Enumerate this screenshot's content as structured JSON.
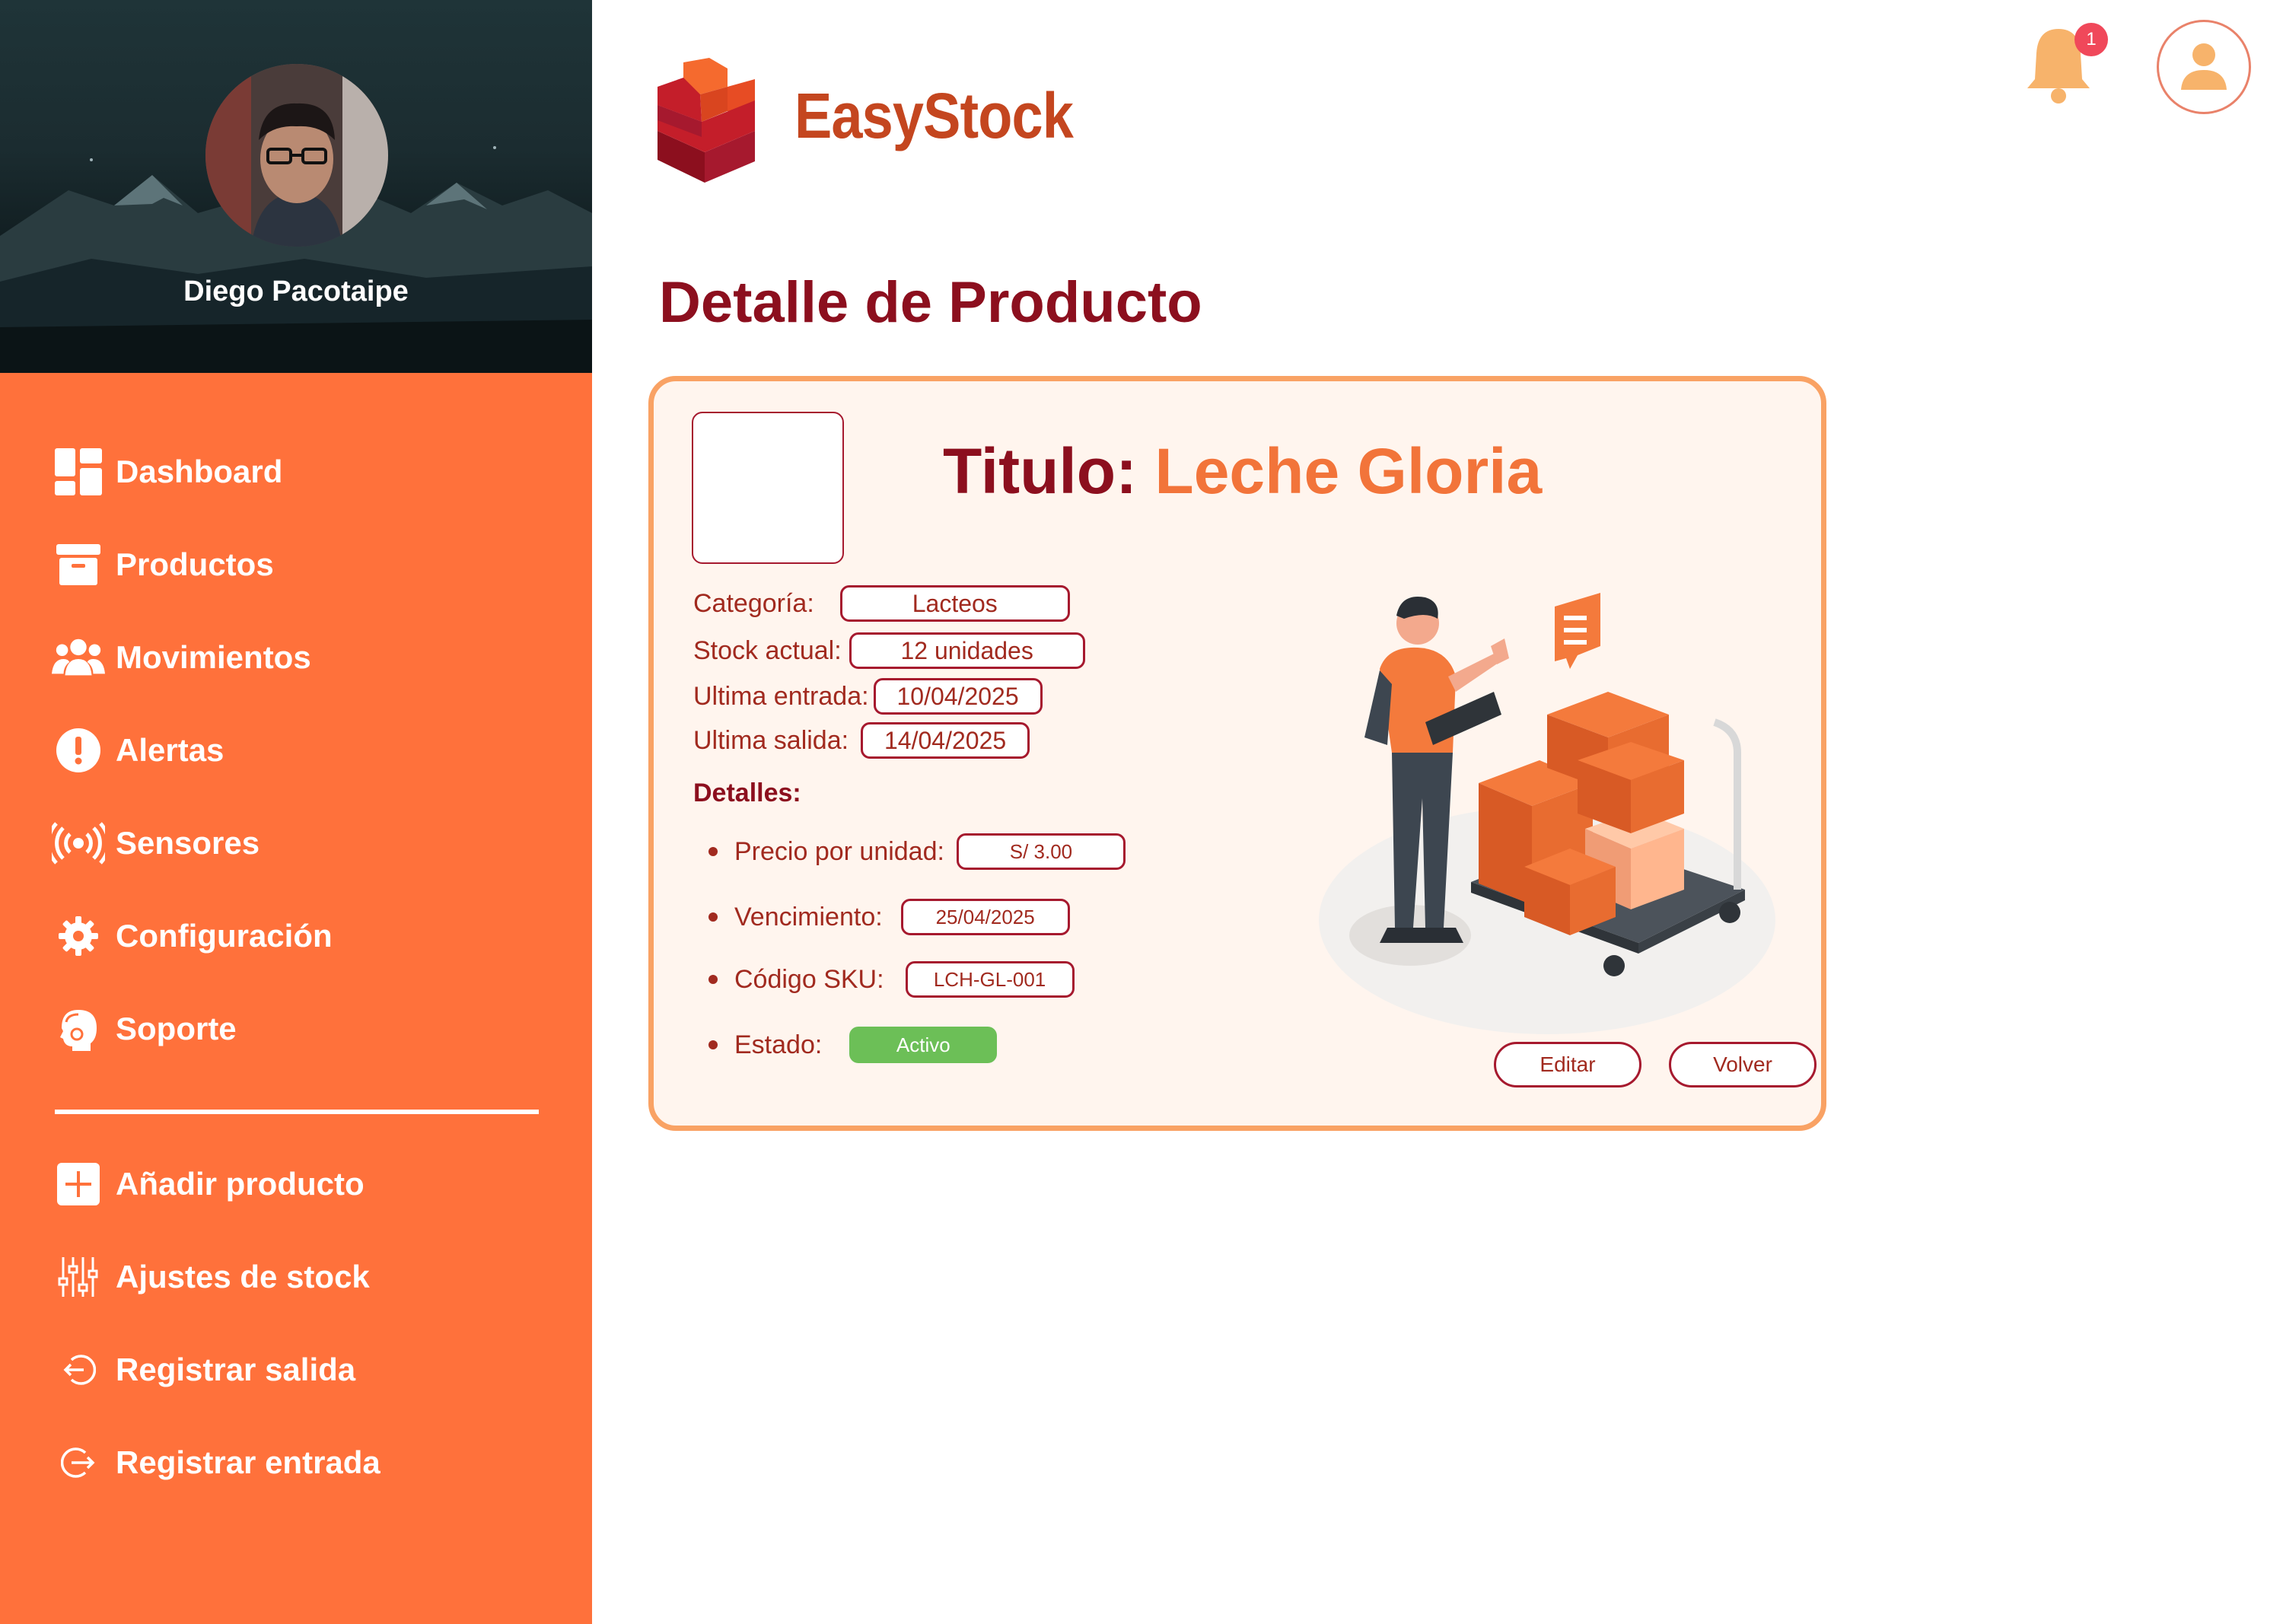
{
  "app": {
    "name": "EasyStock"
  },
  "user": {
    "name": "Diego Pacotaipe"
  },
  "notifications": {
    "count": "1"
  },
  "sidebar": {
    "items": [
      {
        "label": "Dashboard",
        "icon": "dashboard-icon"
      },
      {
        "label": "Productos",
        "icon": "archive-icon"
      },
      {
        "label": "Movimientos",
        "icon": "users-icon"
      },
      {
        "label": "Alertas",
        "icon": "alert-icon"
      },
      {
        "label": "Sensores",
        "icon": "sensor-icon"
      },
      {
        "label": "Configuración",
        "icon": "gear-icon"
      },
      {
        "label": "Soporte",
        "icon": "support-icon"
      }
    ],
    "actions": [
      {
        "label": "Añadir producto",
        "icon": "plus-icon"
      },
      {
        "label": "Ajustes de stock",
        "icon": "sliders-icon"
      },
      {
        "label": "Registrar salida",
        "icon": "exit-icon"
      },
      {
        "label": "Registrar entrada",
        "icon": "enter-icon"
      }
    ]
  },
  "page": {
    "title": "Detalle de Producto"
  },
  "product": {
    "title_label": "Titulo:",
    "title_value": "Leche Gloria",
    "fields": [
      {
        "label": "Categoría:",
        "value": "Lacteos"
      },
      {
        "label": "Stock actual:",
        "value": "12 unidades"
      },
      {
        "label": "Ultima entrada:",
        "value": "10/04/2025"
      },
      {
        "label": "Ultima salida:",
        "value": "14/04/2025"
      }
    ],
    "details_heading": "Detalles:",
    "details": [
      {
        "label": "Precio por unidad:",
        "value": "S/ 3.00"
      },
      {
        "label": "Vencimiento:",
        "value": "25/04/2025"
      },
      {
        "label": "Código SKU:",
        "value": "LCH-GL-001"
      },
      {
        "label": "Estado:",
        "value": "Activo"
      }
    ],
    "buttons": {
      "edit": "Editar",
      "back": "Volver"
    }
  },
  "colors": {
    "sidebar": "#FF713B",
    "title": "#8C0F1E",
    "accent": "#F2743A",
    "status_active": "#6CBF57"
  }
}
